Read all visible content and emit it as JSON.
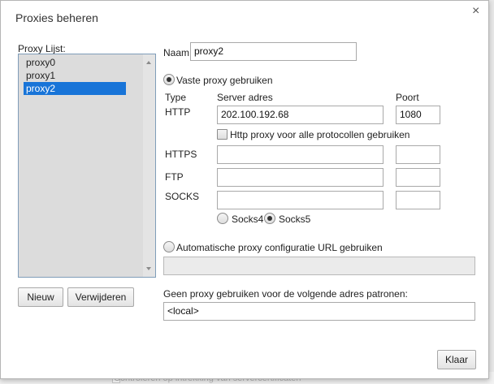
{
  "dialog": {
    "title": "Proxies beheren",
    "close_symbol": "×"
  },
  "proxy_list": {
    "label": "Proxy Lijst:",
    "items": [
      "proxy0",
      "proxy1",
      "proxy2"
    ],
    "selected_index": 2
  },
  "list_buttons": {
    "new_label": "Nieuw",
    "delete_label": "Verwijderen"
  },
  "name_field": {
    "label": "Naam:",
    "value": "proxy2"
  },
  "manual_proxy": {
    "radio_label": "Vaste proxy gebruiken",
    "checked": true,
    "col_type": "Type",
    "col_server": "Server adres",
    "col_port": "Poort",
    "http": {
      "label": "HTTP",
      "server": "202.100.192.68",
      "port": "1080"
    },
    "use_http_for_all_label": "Http proxy voor alle protocollen gebruiken",
    "use_http_for_all_checked": false,
    "https": {
      "label": "HTTPS",
      "server": "",
      "port": ""
    },
    "ftp": {
      "label": "FTP",
      "server": "",
      "port": ""
    },
    "socks": {
      "label": "SOCKS",
      "server": "",
      "port": ""
    },
    "socks4_label": "Socks4",
    "socks5_label": "Socks5",
    "socks_version_selected": "Socks5"
  },
  "auto_proxy": {
    "radio_label": "Automatische proxy configuratie URL gebruiken",
    "checked": false,
    "url": ""
  },
  "bypass": {
    "label": "Geen proxy gebruiken voor de volgende adres patronen:",
    "value": "<local>"
  },
  "footer": {
    "ok_label": "Klaar"
  },
  "background": {
    "partial_text": "Controleren op intrekking van servercertificaten"
  }
}
